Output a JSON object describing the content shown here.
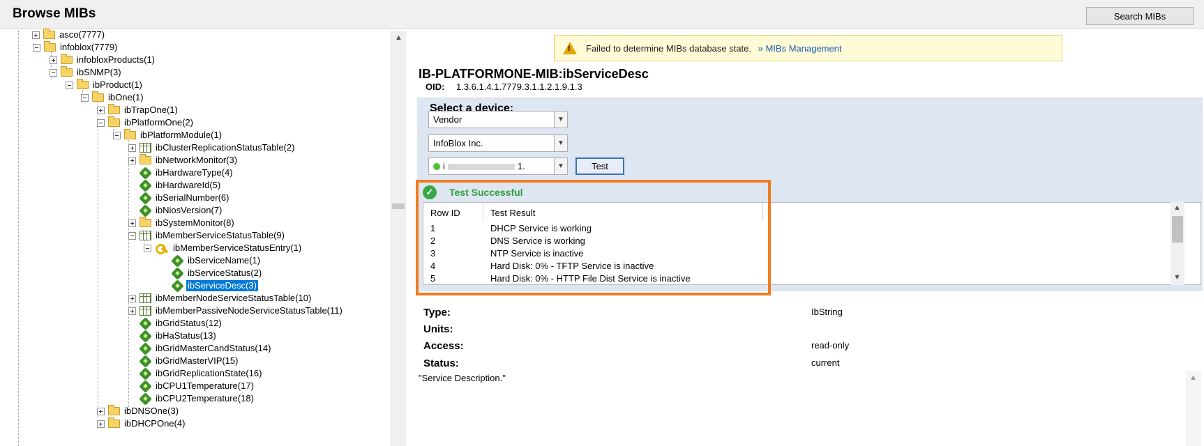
{
  "header": {
    "title": "Browse MIBs",
    "search_button": "Search MIBs"
  },
  "tree": {
    "nodes": [
      {
        "label": "asco(7777)"
      },
      {
        "label": "infoblox(7779)"
      },
      {
        "label": "infobloxProducts(1)"
      },
      {
        "label": "ibSNMP(3)"
      },
      {
        "label": "ibProduct(1)"
      },
      {
        "label": "ibOne(1)"
      },
      {
        "label": "ibTrapOne(1)"
      },
      {
        "label": "ibPlatformOne(2)"
      },
      {
        "label": "ibPlatformModule(1)"
      },
      {
        "label": "ibClusterReplicationStatusTable(2)"
      },
      {
        "label": "ibNetworkMonitor(3)"
      },
      {
        "label": "ibHardwareType(4)"
      },
      {
        "label": "ibHardwareId(5)"
      },
      {
        "label": "ibSerialNumber(6)"
      },
      {
        "label": "ibNiosVersion(7)"
      },
      {
        "label": "ibSystemMonitor(8)"
      },
      {
        "label": "ibMemberServiceStatusTable(9)"
      },
      {
        "label": "ibMemberServiceStatusEntry(1)"
      },
      {
        "label": "ibServiceName(1)"
      },
      {
        "label": "ibServiceStatus(2)"
      },
      {
        "label": "ibServiceDesc(3)"
      },
      {
        "label": "ibMemberNodeServiceStatusTable(10)"
      },
      {
        "label": "ibMemberPassiveNodeServiceStatusTable(11)"
      },
      {
        "label": "ibGridStatus(12)"
      },
      {
        "label": "ibHaStatus(13)"
      },
      {
        "label": "ibGridMasterCandStatus(14)"
      },
      {
        "label": "ibGridMasterVIP(15)"
      },
      {
        "label": "ibGridReplicationState(16)"
      },
      {
        "label": "ibCPU1Temperature(17)"
      },
      {
        "label": "ibCPU2Temperature(18)"
      },
      {
        "label": "ibDNSOne(3)"
      },
      {
        "label": "ibDHCPOne(4)"
      }
    ]
  },
  "warning": {
    "text": "Failed to determine MIBs database state.",
    "link": "» MIBs Management"
  },
  "mib": {
    "name": "IB-PLATFORMONE-MIB:ibServiceDesc",
    "oid_label": "OID:",
    "oid": "1.3.6.1.4.1.7779.3.1.1.2.1.9.1.3"
  },
  "device": {
    "heading": "Select a device:",
    "vendor_field": "Vendor",
    "vendor_value": "InfoBlox Inc.",
    "device_value": "i",
    "device_value_tail": "1.",
    "test_button": "Test"
  },
  "result": {
    "status": "Test Successful",
    "columns": [
      "Row ID",
      "Test Result"
    ],
    "rows": [
      [
        "1",
        "DHCP Service is working"
      ],
      [
        "2",
        "DNS Service is working"
      ],
      [
        "3",
        "NTP Service is inactive"
      ],
      [
        "4",
        "Hard Disk: 0% - TFTP Service is inactive"
      ],
      [
        "5",
        "Hard Disk: 0% - HTTP File Dist Service is inactive"
      ]
    ]
  },
  "properties": {
    "type_label": "Type:",
    "type_value": "IbString",
    "units_label": "Units:",
    "access_label": "Access:",
    "access_value": "read-only",
    "status_label": "Status:",
    "status_value": "current"
  },
  "description": "\"Service Description.\"",
  "colors": {
    "selection": "#0078d7",
    "highlight_frame": "#f07c21",
    "success": "#2e9e3e",
    "device_panel": "#dde6f1",
    "warning_bg": "#fffbd6"
  }
}
